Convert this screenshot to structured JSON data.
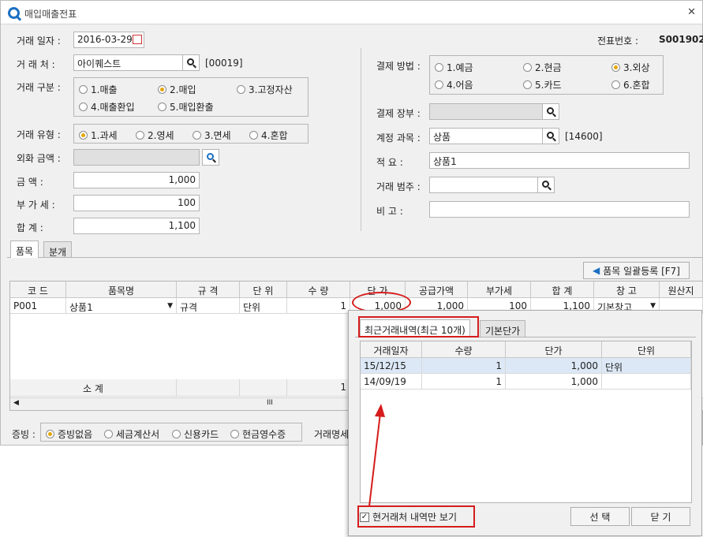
{
  "window": {
    "title": "매입매출전표",
    "close": "✕"
  },
  "form": {
    "date_label": "거래 일자 :",
    "date_value": "2016-03-29",
    "voucher_label": "전표번호 :",
    "voucher_value": "S001902",
    "client_label": "거 래 처 :",
    "client_value": "아이퀘스트",
    "client_code": "[00019]",
    "kind_label": "거래 구분 :",
    "kind_options": [
      "1.매출",
      "2.매입",
      "3.고정자산",
      "4.매출환입",
      "5.매입환출"
    ],
    "kind_selected": "2.매입",
    "type_label": "거래 유형 :",
    "type_options": [
      "1.과세",
      "2.영세",
      "3.면세",
      "4.혼합"
    ],
    "type_selected": "1.과세",
    "fx_label": "외화 금액 :",
    "amount_label": "금      액 :",
    "amount_value": "1,000",
    "vat_label": "부 가 세 :",
    "vat_value": "100",
    "total_label": "합      계 :",
    "total_value": "1,100",
    "pay_label": "결제 방법 :",
    "pay_options": [
      "1.예금",
      "2.현금",
      "3.외상",
      "4.어음",
      "5.카드",
      "6.혼합"
    ],
    "pay_selected": "3.외상",
    "ledger_label": "결제 장부 :",
    "account_label": "계정 과목 :",
    "account_value": "상품",
    "account_code": "[14600]",
    "memo_label": "적      요 :",
    "memo_value": "상품1",
    "category_label": "거래 범주 :",
    "note_label": "비      고 :"
  },
  "tabs": [
    "품목",
    "분개"
  ],
  "bulk_button": "품목 일괄등록 [F7]",
  "items_grid": {
    "headers": [
      "코 드",
      "품목명",
      "규 격",
      "단 위",
      "수 량",
      "단 가",
      "공급가액",
      "부가세",
      "합 계",
      "창 고",
      "원산지"
    ],
    "row": [
      "P001",
      "상품1",
      "규격",
      "단위",
      "1",
      "1,000",
      "1,000",
      "100",
      "1,100",
      "기본창고"
    ],
    "subtotal_label": "소      계",
    "subtotal_qty": "1",
    "scroll_mark": "III"
  },
  "evidence": {
    "label": "증빙 :",
    "options": [
      "증빙없음",
      "세금계산서",
      "신용카드",
      "현금영수증"
    ],
    "selected": "증빙없음",
    "trade_stmt": "거래명세"
  },
  "popup": {
    "tabs": [
      "최근거래내역(최근 10개)",
      "기본단가"
    ],
    "headers": [
      "거래일자",
      "수량",
      "단가",
      "단위"
    ],
    "rows": [
      [
        "15/12/15",
        "1",
        "1,000",
        "단위"
      ],
      [
        "14/09/19",
        "1",
        "1,000",
        ""
      ]
    ],
    "checkbox_label": "현거래처 내역만 보기",
    "select_button": "선 택",
    "close_button": "닫 기"
  },
  "colors": {
    "highlight": "#d61c1c",
    "radio_on": "#e6a400",
    "selected_row": "#dce8f6"
  }
}
